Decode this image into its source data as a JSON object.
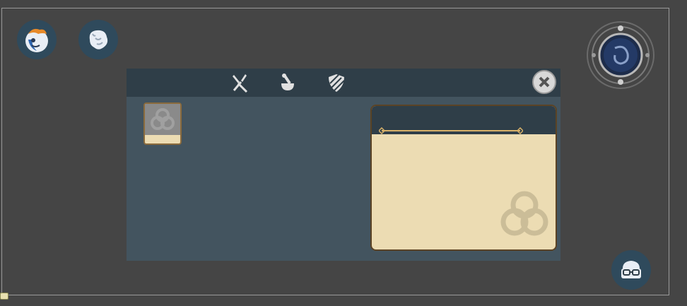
{
  "hud": {
    "buttons": [
      {
        "name": "hero-portrait",
        "icon": "hero-icon"
      },
      {
        "name": "spirit-companion",
        "icon": "spirit-icon"
      },
      {
        "name": "inventory-character",
        "icon": "glasses-icon"
      }
    ],
    "minimap": {
      "icon": "compass-orb-icon"
    }
  },
  "crafting_panel": {
    "tabs": [
      {
        "id": "tools",
        "icon": "crossed-tools-icon"
      },
      {
        "id": "alchemy",
        "icon": "mortar-pestle-icon"
      },
      {
        "id": "armor",
        "icon": "shield-icon"
      }
    ],
    "close_icon": "close-icon",
    "selected_item": {
      "icon": "celtic-knot-icon",
      "title": "",
      "description": ""
    }
  },
  "colors": {
    "background": "#454545",
    "panel": "#43545f",
    "panel_header": "#2f3e48",
    "parchment": "#ecdcb3",
    "accent_gold": "#d9b26a"
  }
}
